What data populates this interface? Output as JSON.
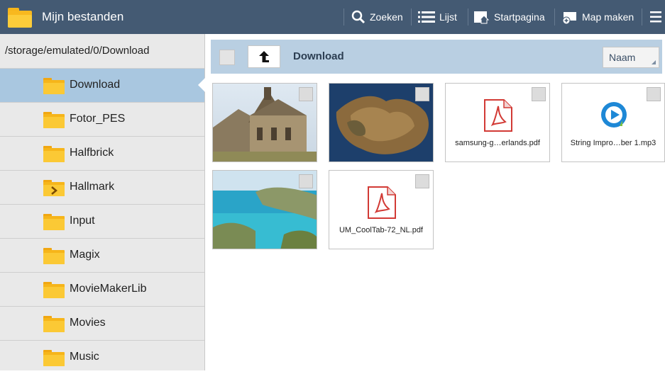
{
  "app": {
    "title": "Mijn bestanden"
  },
  "toolbar": {
    "search_label": "Zoeken",
    "list_label": "Lijst",
    "home_label": "Startpagina",
    "new_folder_label": "Map maken"
  },
  "sidebar": {
    "path": "/storage/emulated/0/Download",
    "folders": [
      {
        "label": "Download",
        "selected": true
      },
      {
        "label": "Fotor_PES"
      },
      {
        "label": "Halfbrick"
      },
      {
        "label": "Hallmark"
      },
      {
        "label": "Input"
      },
      {
        "label": "Magix"
      },
      {
        "label": "MovieMakerLib"
      },
      {
        "label": "Movies"
      },
      {
        "label": "Music"
      }
    ]
  },
  "content": {
    "breadcrumb": "Download",
    "sort_value": "Naam",
    "files": [
      {
        "name": "",
        "type": "image",
        "thumb": "church"
      },
      {
        "name": "",
        "type": "image",
        "thumb": "island"
      },
      {
        "name": "samsung-g…erlands.pdf",
        "type": "pdf"
      },
      {
        "name": "String Impro…ber 1.mp3",
        "type": "audio"
      },
      {
        "name": "",
        "type": "image",
        "thumb": "coast"
      },
      {
        "name": "UM_CoolTab-72_NL.pdf",
        "type": "pdf"
      }
    ]
  },
  "colors": {
    "actionbar": "#445a73",
    "selected_row": "#a9c7e0",
    "content_header": "#b9cfe2",
    "folder": "#f6b51a"
  }
}
